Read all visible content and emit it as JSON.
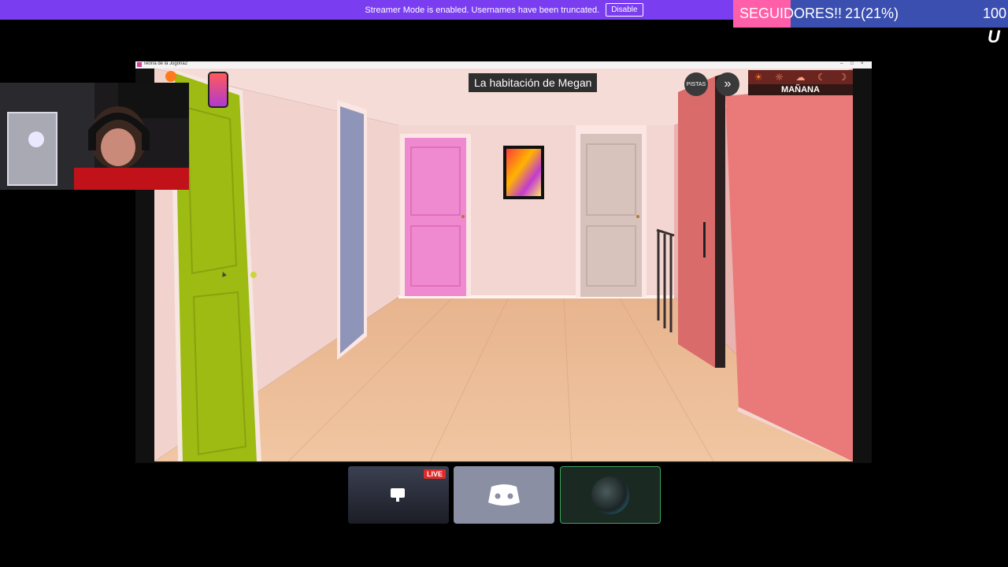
{
  "banner": {
    "message": "Streamer Mode is enabled. Usernames have been truncated.",
    "disable_label": "Disable"
  },
  "goal": {
    "label": "SEGUIDORES!!",
    "current": "21(21%)",
    "target": "100",
    "progress_fraction": 0.21,
    "fill_color": "#ff5fa8",
    "track_color": "#3b4fb0"
  },
  "ticker_text": "U",
  "game_window": {
    "title": "Teoría de la Jugona2",
    "controls": [
      "–",
      "□",
      "×"
    ]
  },
  "game_hud": {
    "location": "La habitación de Megan",
    "time_of_day": "MAÑANA",
    "time_icons": [
      "sunrise-icon",
      "sun-icon",
      "cloud-sun-icon",
      "moon-icon",
      "crescent-icon"
    ],
    "buttons": {
      "pistas_label": "PISTAS",
      "skip_icon": "fast-forward-icon"
    },
    "phone_icon": "phone-icon"
  },
  "dock": {
    "live_badge": "LIVE",
    "items": [
      "screen-share-tile",
      "discord-tile",
      "avatar-tile"
    ]
  },
  "colors": {
    "banner": "#7a3df0",
    "green_door": "#9dbb12",
    "pink_door": "#f08ad0",
    "grey_door": "#8f95b8",
    "beige_door": "#d8c2bc",
    "right_wall": "#ea7a7a"
  }
}
